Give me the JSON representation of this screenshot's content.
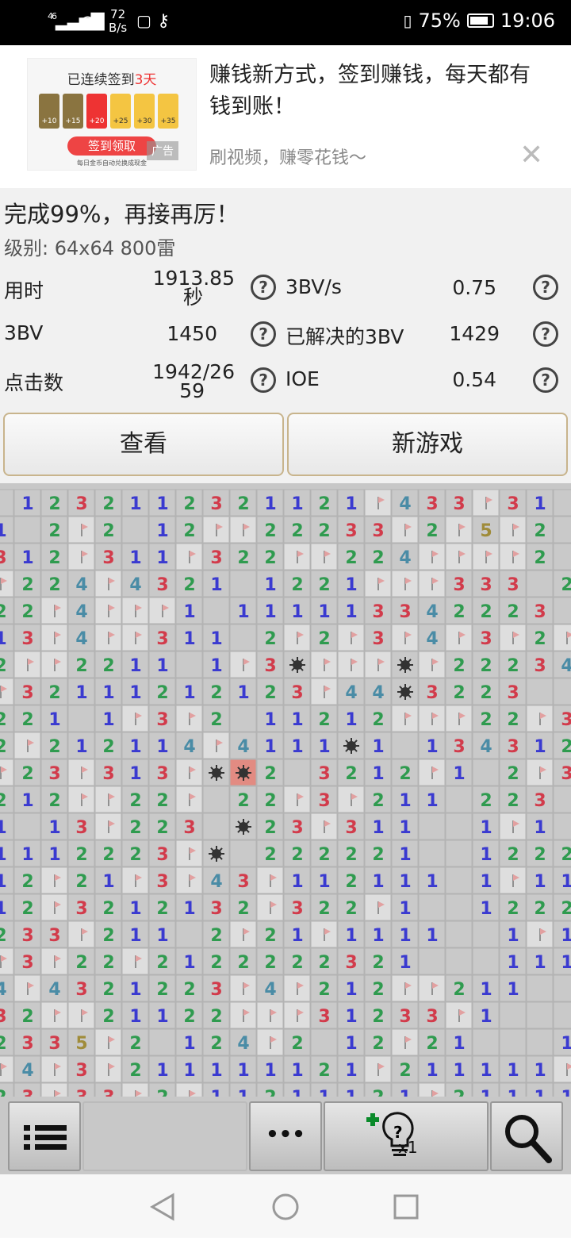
{
  "status_bar": {
    "network": "46",
    "speed_value": "72",
    "speed_unit": "B/s",
    "battery": "75%",
    "time": "19:06"
  },
  "ad": {
    "thumb_title_prefix": "已连续签到",
    "thumb_title_days": "3天",
    "day_rewards": [
      "+10",
      "+15",
      "+20",
      "+25",
      "+30",
      "+35"
    ],
    "thumb_button": "签到领取",
    "ad_tag": "广告",
    "thumb_small": "每日金币自动兑换成现金",
    "headline": "赚钱新方式，签到赚钱，每天都有钱到账！",
    "subtitle": "刷视频，赚零花钱～",
    "close_glyph": "✕"
  },
  "result": {
    "title": "完成99%，再接再厉！",
    "level": "级别: 64x64  800雷",
    "stats_left": [
      {
        "label": "用时",
        "value_line1": "1913.85",
        "value_line2": "秒"
      },
      {
        "label": "3BV",
        "value_line1": "1450",
        "value_line2": ""
      },
      {
        "label": "点击数",
        "value_line1": "1942/26",
        "value_line2": "59"
      }
    ],
    "stats_right": [
      {
        "label": "3BV/s",
        "value": "0.75"
      },
      {
        "label": "已解决的3BV",
        "value": "1429"
      },
      {
        "label": "IOE",
        "value": "0.54"
      }
    ],
    "help_glyph": "?",
    "view_button": "查看",
    "new_game_button": "新游戏"
  },
  "toolbar": {
    "hint_count": "x1",
    "more_glyph": "•••"
  },
  "colors": {
    "n1": "#3a3ad0",
    "n2": "#2f9b4f",
    "n3": "#d23b4b",
    "n4": "#4a8ca6",
    "n5": "#a08c3a",
    "cell": "#c9c9c9",
    "covered": "#dedede",
    "exploded": "#e28b82"
  },
  "board": {
    "rows": [
      " 1232112321121B433B31  ",
      "1 2B2 12BB22233B2B5B2  ",
      "312B311B322BB224BBBB2  ",
      "B224B4321 1221BBB333 21",
      "22B4BBB1 111113342223",
      "13B4BB311 2B2B3B4B3B2B3B4",
      "2BB2211 1B3*BBB*B22234",
      "B32111212123B44*3223",
      "221 1B3B2 11212BBB22B3",
      "2B212114B4111*1 134312BB3",
      "B23B313B*X2 3212B1 2B3",
      "212BB22B 22B3B211 223",
      "1 13B223 *23B311  1B1",
      "1112223B* 222221  1222",
      "12B21B3B43B112111 1B11",
      "12B3212132B322B1  1222",
      "233B211 2B21B1111  1B1",
      "B3B22B2122222321   111",
      "4B4321223B4B212BB211",
      "32BB21122BBB31233B1",
      "2335B2 124B2 12B21   11",
      "B4B3B211111121B211111B2B",
      "23B33B2B11211121B211111"
    ]
  }
}
